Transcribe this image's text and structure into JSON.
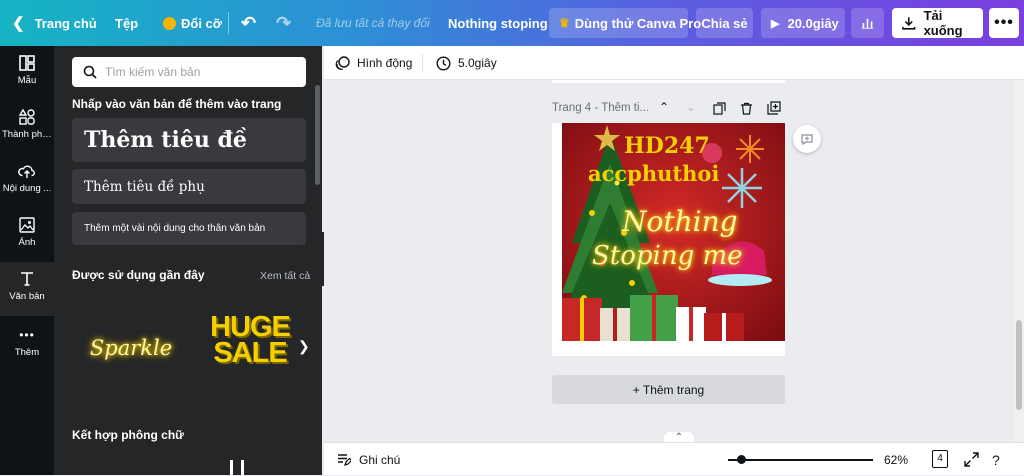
{
  "topbar": {
    "home": "Trang chủ",
    "file": "Tệp",
    "resize": "Đổi cỡ",
    "saved_status": "Đã lưu tất cả thay đổi",
    "design_title": "Nothing stoping",
    "try_pro": "Dùng thử Canva Pro",
    "share": "Chia sẻ",
    "play_duration": "20.0giây",
    "download": "Tải xuống"
  },
  "rail": {
    "items": [
      {
        "label": "Mẫu",
        "icon": "template-icon"
      },
      {
        "label": "Thành phần",
        "icon": "elements-icon"
      },
      {
        "label": "Nội dung ...",
        "icon": "upload-cloud-icon"
      },
      {
        "label": "Ảnh",
        "icon": "photo-icon"
      },
      {
        "label": "Văn bản",
        "icon": "text-icon"
      },
      {
        "label": "Thêm",
        "icon": "more-icon"
      }
    ]
  },
  "panel": {
    "search_placeholder": "Tìm kiếm văn bản",
    "hint": "Nhấp vào văn bản để thêm vào trang",
    "add_heading": "Thêm tiêu đề",
    "add_subheading": "Thêm tiêu đề phụ",
    "add_body": "Thêm một vài nội dung cho thân văn bản",
    "recent_title": "Được sử dụng gần đây",
    "see_all": "Xem tất cả",
    "recent_items": [
      "Sparkle",
      "HUGE",
      "SALE"
    ],
    "font_combo_title": "Kết hợp phông chữ"
  },
  "toolbar": {
    "animate": "Hình động",
    "duration": "5.0giây"
  },
  "canvas": {
    "page_label": "Trang 4 - Thêm ti...",
    "design_line1": "HD247",
    "design_line2": "accphuthoi",
    "design_script1": "Nothing",
    "design_script2": "Stoping me",
    "add_page": "+ Thêm trang"
  },
  "bottombar": {
    "notes": "Ghi chú",
    "zoom": "62%",
    "page_count": "4",
    "zoom_fraction": 0.33
  },
  "colors": {
    "rail_bg": "#0e1318",
    "panel_bg": "#252627",
    "card_bg": "#383a3e",
    "gold": "#f5d000",
    "pro_crown": "#f7b500",
    "design_red": "#b3141c"
  }
}
